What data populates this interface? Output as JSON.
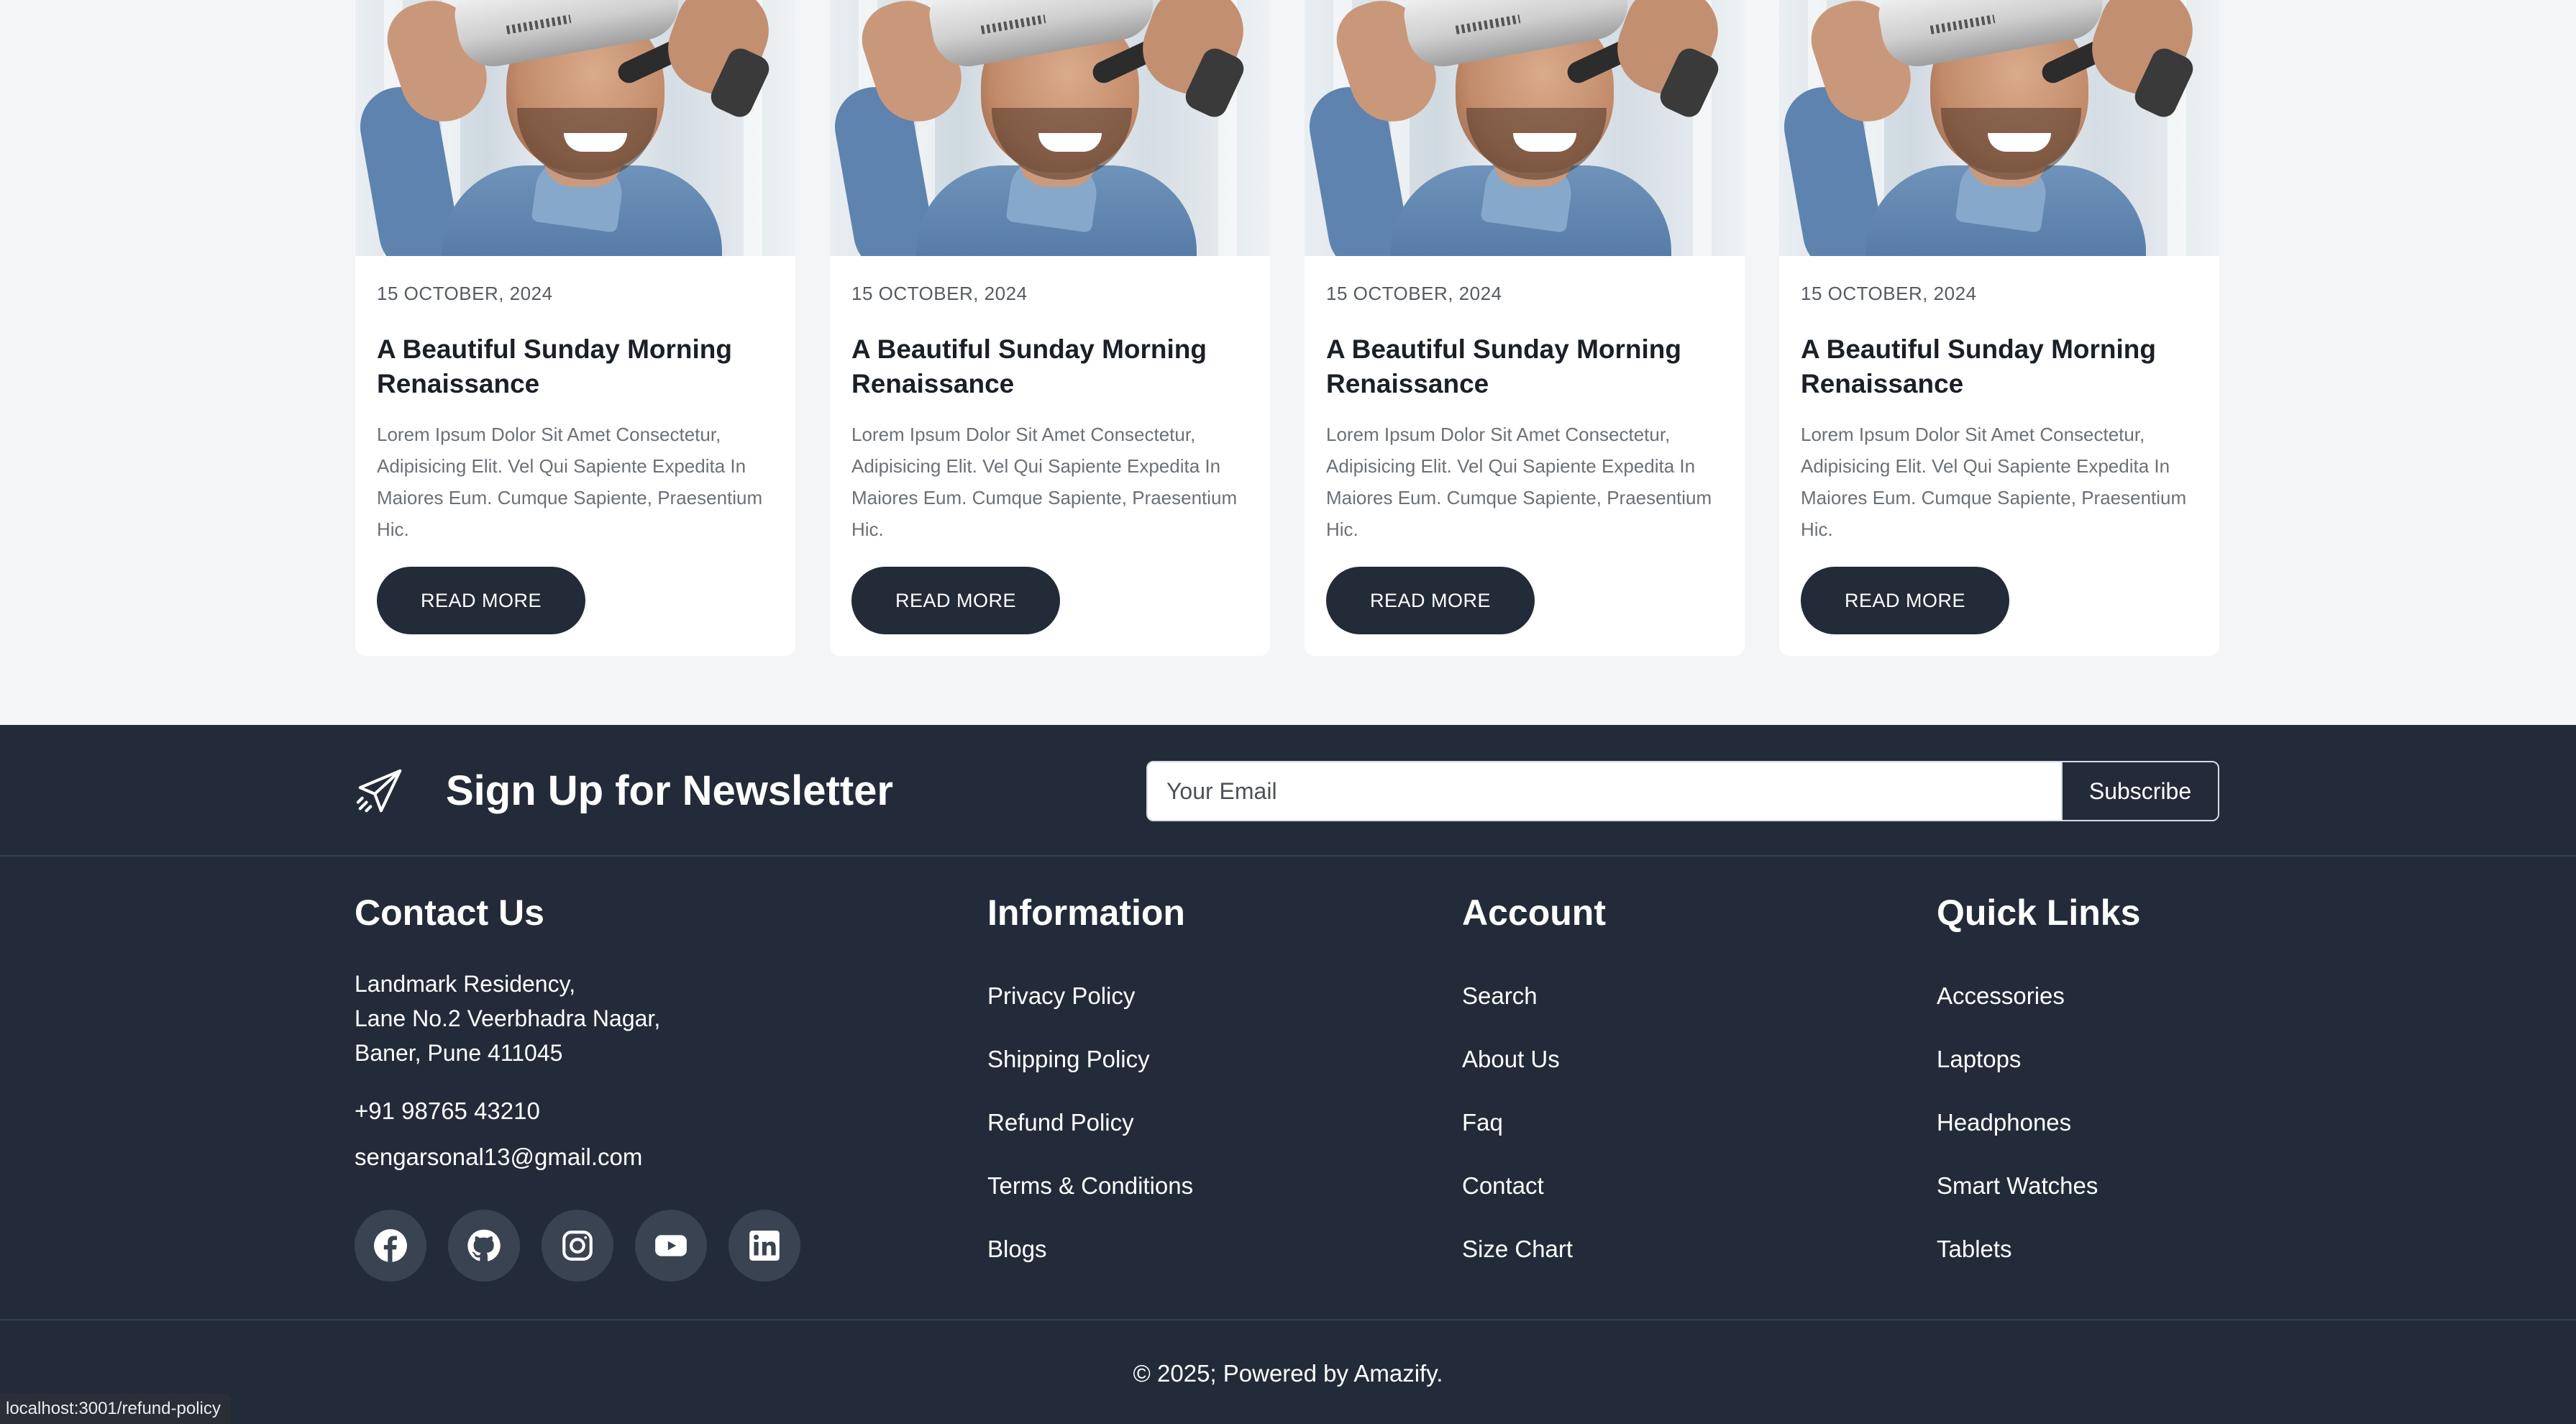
{
  "blog": {
    "cards": [
      {
        "date": "15 OCTOBER, 2024",
        "title": "A Beautiful Sunday Morning Renaissance",
        "description": "Lorem Ipsum Dolor Sit Amet Consectetur, Adipisicing Elit. Vel Qui Sapiente Expedita In Maiores Eum. Cumque Sapiente, Praesentium Hic.",
        "button": "READ MORE"
      },
      {
        "date": "15 OCTOBER, 2024",
        "title": "A Beautiful Sunday Morning Renaissance",
        "description": "Lorem Ipsum Dolor Sit Amet Consectetur, Adipisicing Elit. Vel Qui Sapiente Expedita In Maiores Eum. Cumque Sapiente, Praesentium Hic.",
        "button": "READ MORE"
      },
      {
        "date": "15 OCTOBER, 2024",
        "title": "A Beautiful Sunday Morning Renaissance",
        "description": "Lorem Ipsum Dolor Sit Amet Consectetur, Adipisicing Elit. Vel Qui Sapiente Expedita In Maiores Eum. Cumque Sapiente, Praesentium Hic.",
        "button": "READ MORE"
      },
      {
        "date": "15 OCTOBER, 2024",
        "title": "A Beautiful Sunday Morning Renaissance",
        "description": "Lorem Ipsum Dolor Sit Amet Consectetur, Adipisicing Elit. Vel Qui Sapiente Expedita In Maiores Eum. Cumque Sapiente, Praesentium Hic.",
        "button": "READ MORE"
      }
    ]
  },
  "newsletter": {
    "icon": "paper-plane-icon",
    "title": "Sign Up for Newsletter",
    "email_placeholder": "Your Email",
    "subscribe_label": "Subscribe"
  },
  "contact": {
    "heading": "Contact Us",
    "address": [
      "Landmark Residency,",
      "Lane No.2 Veerbhadra Nagar,",
      "Baner, Pune 411045"
    ],
    "phone": "+91 98765 43210",
    "email": "sengarsonal13@gmail.com",
    "social": [
      "facebook-icon",
      "github-icon",
      "instagram-icon",
      "youtube-icon",
      "linkedin-icon"
    ]
  },
  "information": {
    "heading": "Information",
    "links": [
      "Privacy Policy",
      "Shipping Policy",
      "Refund Policy",
      "Terms & Conditions",
      "Blogs"
    ]
  },
  "account": {
    "heading": "Account",
    "links": [
      "Search",
      "About Us",
      "Faq",
      "Contact",
      "Size Chart"
    ]
  },
  "quick_links": {
    "heading": "Quick Links",
    "links": [
      "Accessories",
      "Laptops",
      "Headphones",
      "Smart Watches",
      "Tablets"
    ]
  },
  "copyright": "© 2025; Powered by Amazify.",
  "status_url": "localhost:3001/refund-policy",
  "colors": {
    "page_bg": "#f4f5f7",
    "footer_bg": "#232b3a",
    "button_dark": "#232b38",
    "social_bg": "#3a4352"
  }
}
